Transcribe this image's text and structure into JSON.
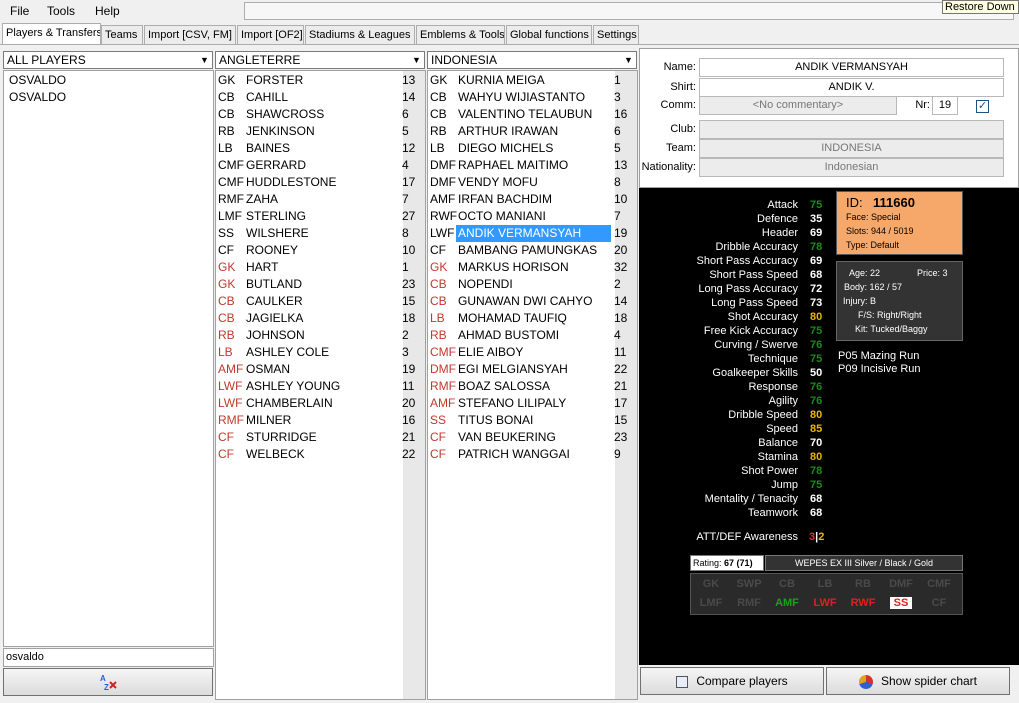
{
  "menu": [
    "File",
    "Tools",
    "Help"
  ],
  "tooltip": "Restore Down",
  "tabs": [
    "Players & Transfers",
    "Teams",
    "Import [CSV, FM]",
    "Import [OF2]",
    "Stadiums & Leagues",
    "Emblems & Tools",
    "Global functions",
    "Settings"
  ],
  "all_players": {
    "combo": "ALL PLAYERS",
    "items": [
      "OSVALDO",
      "OSVALDO"
    ],
    "search_value": "osvaldo"
  },
  "team1": {
    "combo": "ANGLETERRE",
    "players": [
      {
        "pos": "GK",
        "name": "FORSTER",
        "num": "13",
        "sub": false
      },
      {
        "pos": "CB",
        "name": "CAHILL",
        "num": "14",
        "sub": false
      },
      {
        "pos": "CB",
        "name": "SHAWCROSS",
        "num": "6",
        "sub": false
      },
      {
        "pos": "RB",
        "name": "JENKINSON",
        "num": "5",
        "sub": false
      },
      {
        "pos": "LB",
        "name": "BAINES",
        "num": "12",
        "sub": false
      },
      {
        "pos": "CMF",
        "name": "GERRARD",
        "num": "4",
        "sub": false
      },
      {
        "pos": "CMF",
        "name": "HUDDLESTONE",
        "num": "17",
        "sub": false
      },
      {
        "pos": "RMF",
        "name": "ZAHA",
        "num": "7",
        "sub": false
      },
      {
        "pos": "LMF",
        "name": "STERLING",
        "num": "27",
        "sub": false
      },
      {
        "pos": "SS",
        "name": "WILSHERE",
        "num": "8",
        "sub": false
      },
      {
        "pos": "CF",
        "name": "ROONEY",
        "num": "10",
        "sub": false
      },
      {
        "pos": "GK",
        "name": "HART",
        "num": "1",
        "sub": true
      },
      {
        "pos": "GK",
        "name": "BUTLAND",
        "num": "23",
        "sub": true
      },
      {
        "pos": "CB",
        "name": "CAULKER",
        "num": "15",
        "sub": true
      },
      {
        "pos": "CB",
        "name": "JAGIELKA",
        "num": "18",
        "sub": true
      },
      {
        "pos": "RB",
        "name": "JOHNSON",
        "num": "2",
        "sub": true
      },
      {
        "pos": "LB",
        "name": "ASHLEY COLE",
        "num": "3",
        "sub": true
      },
      {
        "pos": "AMF",
        "name": "OSMAN",
        "num": "19",
        "sub": true
      },
      {
        "pos": "LWF",
        "name": "ASHLEY YOUNG",
        "num": "11",
        "sub": true
      },
      {
        "pos": "LWF",
        "name": "CHAMBERLAIN",
        "num": "20",
        "sub": true
      },
      {
        "pos": "RMF",
        "name": "MILNER",
        "num": "16",
        "sub": true
      },
      {
        "pos": "CF",
        "name": "STURRIDGE",
        "num": "21",
        "sub": true
      },
      {
        "pos": "CF",
        "name": "WELBECK",
        "num": "22",
        "sub": true
      }
    ]
  },
  "team2": {
    "combo": "INDONESIA",
    "players": [
      {
        "pos": "GK",
        "name": "KURNIA MEIGA",
        "num": "1",
        "sub": false
      },
      {
        "pos": "CB",
        "name": "WAHYU WIJIASTANTO",
        "num": "3",
        "sub": false
      },
      {
        "pos": "CB",
        "name": "VALENTINO TELAUBUN",
        "num": "16",
        "sub": false
      },
      {
        "pos": "RB",
        "name": "ARTHUR IRAWAN",
        "num": "6",
        "sub": false
      },
      {
        "pos": "LB",
        "name": "DIEGO MICHELS",
        "num": "5",
        "sub": false
      },
      {
        "pos": "DMF",
        "name": "RAPHAEL MAITIMO",
        "num": "13",
        "sub": false
      },
      {
        "pos": "DMF",
        "name": "VENDY MOFU",
        "num": "8",
        "sub": false
      },
      {
        "pos": "AMF",
        "name": "IRFAN BACHDIM",
        "num": "10",
        "sub": false
      },
      {
        "pos": "RWF",
        "name": "OCTO MANIANI",
        "num": "7",
        "sub": false
      },
      {
        "pos": "LWF",
        "name": "ANDIK VERMANSYAH",
        "num": "19",
        "sub": false
      },
      {
        "pos": "CF",
        "name": "BAMBANG PAMUNGKAS",
        "num": "20",
        "sub": false
      },
      {
        "pos": "GK",
        "name": "MARKUS HORISON",
        "num": "32",
        "sub": true
      },
      {
        "pos": "CB",
        "name": "NOPENDI",
        "num": "2",
        "sub": true
      },
      {
        "pos": "CB",
        "name": "GUNAWAN DWI CAHYO",
        "num": "14",
        "sub": true
      },
      {
        "pos": "LB",
        "name": "MOHAMAD TAUFIQ",
        "num": "18",
        "sub": true
      },
      {
        "pos": "RB",
        "name": "AHMAD BUSTOMI",
        "num": "4",
        "sub": true
      },
      {
        "pos": "CMF",
        "name": "ELIE AIBOY",
        "num": "11",
        "sub": true
      },
      {
        "pos": "DMF",
        "name": "EGI MELGIANSYAH",
        "num": "22",
        "sub": true
      },
      {
        "pos": "RMF",
        "name": "BOAZ SALOSSA",
        "num": "21",
        "sub": true
      },
      {
        "pos": "AMF",
        "name": "STEFANO LILIPALY",
        "num": "17",
        "sub": true
      },
      {
        "pos": "SS",
        "name": "TITUS BONAI",
        "num": "15",
        "sub": true
      },
      {
        "pos": "CF",
        "name": "VAN BEUKERING",
        "num": "23",
        "sub": true
      },
      {
        "pos": "CF",
        "name": "PATRICH WANGGAI",
        "num": "9",
        "sub": true
      }
    ],
    "selected_index": 9
  },
  "details": {
    "name_label": "Name:",
    "name": "ANDIK VERMANSYAH",
    "shirt_label": "Shirt:",
    "shirt": "ANDIK V.",
    "comm_label": "Comm:",
    "comm": "<No commentary>",
    "nr_label": "Nr:",
    "nr": "19",
    "club_label": "Club:",
    "club": "",
    "team_label": "Team:",
    "team": "INDONESIA",
    "nationality_label": "Nationality:",
    "nationality": "Indonesian"
  },
  "stats": [
    {
      "label": "Attack",
      "value": "75",
      "color": "green"
    },
    {
      "label": "Defence",
      "value": "35",
      "color": "white"
    },
    {
      "label": "Header",
      "value": "69",
      "color": "white"
    },
    {
      "label": "Dribble Accuracy",
      "value": "78",
      "color": "green"
    },
    {
      "label": "Short Pass Accuracy",
      "value": "69",
      "color": "white"
    },
    {
      "label": "Short Pass Speed",
      "value": "68",
      "color": "white"
    },
    {
      "label": "Long Pass Accuracy",
      "value": "72",
      "color": "white"
    },
    {
      "label": "Long Pass Speed",
      "value": "73",
      "color": "white"
    },
    {
      "label": "Shot Accuracy",
      "value": "80",
      "color": "yellow"
    },
    {
      "label": "Free Kick Accuracy",
      "value": "75",
      "color": "green"
    },
    {
      "label": "Curving / Swerve",
      "value": "76",
      "color": "green"
    },
    {
      "label": "Technique",
      "value": "75",
      "color": "green"
    },
    {
      "label": "Goalkeeper Skills",
      "value": "50",
      "color": "white"
    },
    {
      "label": "Response",
      "value": "76",
      "color": "green"
    },
    {
      "label": "Agility",
      "value": "76",
      "color": "green"
    },
    {
      "label": "Dribble Speed",
      "value": "80",
      "color": "yellow"
    },
    {
      "label": "Speed",
      "value": "85",
      "color": "yellow"
    },
    {
      "label": "Balance",
      "value": "70",
      "color": "white"
    },
    {
      "label": "Stamina",
      "value": "80",
      "color": "yellow"
    },
    {
      "label": "Shot Power",
      "value": "78",
      "color": "green"
    },
    {
      "label": "Jump",
      "value": "75",
      "color": "green"
    },
    {
      "label": "Mentality / Tenacity",
      "value": "68",
      "color": "white"
    },
    {
      "label": "Teamwork",
      "value": "68",
      "color": "white"
    }
  ],
  "awareness": {
    "label": "ATT/DEF Awareness",
    "att": "3",
    "sep": "|",
    "def": "2"
  },
  "id_box": {
    "id_label": "ID:",
    "id": "111660",
    "face": "Face:  Special",
    "slots": "Slots:  944 / 5019",
    "type": "Type:  Default"
  },
  "info_box": {
    "age": "Age:  22",
    "price": "Price:  3",
    "body": "Body:  162 / 57",
    "injury": "Injury:  B",
    "fs": "F/S:  Right/Right",
    "kit": "Kit:  Tucked/Baggy"
  },
  "skills": [
    "P05 Mazing Run",
    "P09 Incisive Run"
  ],
  "rating": {
    "label": "Rating:",
    "value": "67 (71)",
    "edition": "WEPES EX III Silver / Black / Gold"
  },
  "positions_row1": [
    "GK",
    "SWP",
    "CB",
    "LB",
    "RB",
    "DMF",
    "CMF"
  ],
  "positions_row2": [
    "LMF",
    "RMF",
    "AMF",
    "LWF",
    "RWF",
    "SS",
    "CF"
  ],
  "position_states_row2": [
    "off",
    "off",
    "green",
    "red",
    "red",
    "selected",
    "off"
  ],
  "buttons": {
    "compare": "Compare players",
    "spider": "Show spider chart"
  }
}
